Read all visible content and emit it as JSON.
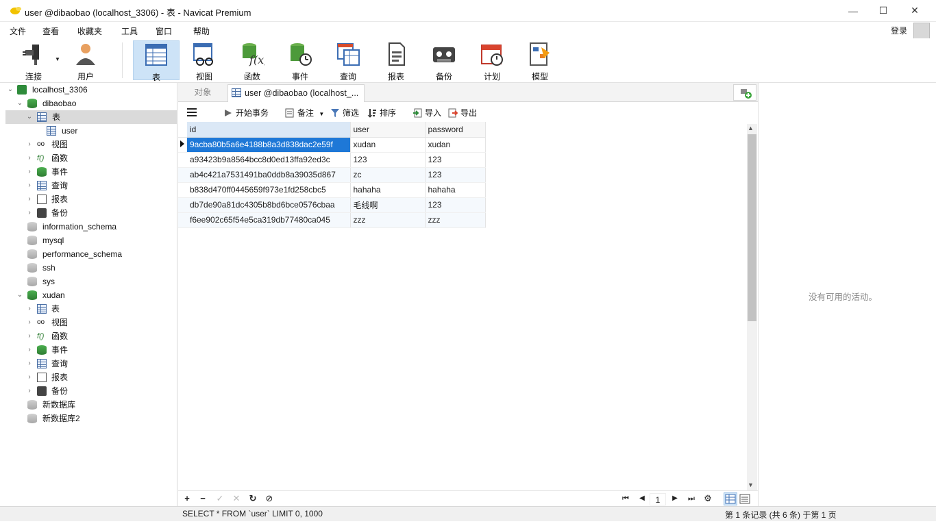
{
  "window": {
    "title": "user @dibaobao (localhost_3306) - 表 - Navicat Premium",
    "min": "—",
    "max": "☐",
    "close": "✕"
  },
  "menu": [
    "文件",
    "查看",
    "收藏夹",
    "工具",
    "窗口",
    "帮助"
  ],
  "login": "登录",
  "toolbar": [
    {
      "label": "连接",
      "icon": "plug-icon"
    },
    {
      "label": "用户",
      "icon": "user-icon"
    },
    {
      "label": "表",
      "icon": "table-icon",
      "active": true
    },
    {
      "label": "视图",
      "icon": "view-icon"
    },
    {
      "label": "函数",
      "icon": "function-icon"
    },
    {
      "label": "事件",
      "icon": "event-icon"
    },
    {
      "label": "查询",
      "icon": "query-icon"
    },
    {
      "label": "报表",
      "icon": "report-icon"
    },
    {
      "label": "备份",
      "icon": "backup-icon"
    },
    {
      "label": "计划",
      "icon": "schedule-icon"
    },
    {
      "label": "模型",
      "icon": "model-icon"
    }
  ],
  "nav": {
    "connection": "localhost_3306",
    "db1": "dibaobao",
    "db1_tables": "表",
    "db1_table_user": "user",
    "db1_items": [
      "视图",
      "函数",
      "事件",
      "查询",
      "报表",
      "备份"
    ],
    "other_dbs": [
      "information_schema",
      "mysql",
      "performance_schema",
      "ssh",
      "sys"
    ],
    "db2": "xudan",
    "db2_items": [
      "表",
      "视图",
      "函数",
      "事件",
      "查询",
      "报表",
      "备份"
    ],
    "extra_dbs": [
      "新数据库",
      "新数据库2"
    ]
  },
  "tabs": {
    "objects": "对象",
    "current": "user @dibaobao (localhost_..."
  },
  "grid_toolbar": {
    "begin_tx": "开始事务",
    "comment": "备注",
    "filter": "筛选",
    "sort": "排序",
    "import": "导入",
    "export": "导出"
  },
  "table": {
    "columns": [
      "id",
      "user",
      "password"
    ],
    "rows": [
      [
        "9acba80b5a6e4188b8a3d838dac2e59f",
        "xudan",
        "xudan"
      ],
      [
        "a93423b9a8564bcc8d0ed13ffa92ed3c",
        "123",
        "123"
      ],
      [
        "ab4c421a7531491ba0ddb8a39035d867",
        "zc",
        "123"
      ],
      [
        "b838d470ff0445659f973e1fd258cbc5",
        "hahaha",
        "hahaha"
      ],
      [
        "db7de90a81dc4305b8bd6bce0576cbaa",
        "毛线啊",
        "123"
      ],
      [
        "f6ee902c65f54e5ca319db77480ca045",
        "zzz",
        "zzz"
      ]
    ]
  },
  "bottom": {
    "add": "+",
    "remove": "−",
    "apply": "✓",
    "discard": "✕",
    "refresh": "↻",
    "stop": "⊘",
    "first": "⏮",
    "prev": "◀",
    "page": "1",
    "next": "▶",
    "last": "⏭",
    "settings": "⚙"
  },
  "status": {
    "sql": "SELECT * FROM `user` LIMIT 0, 1000",
    "records": "第 1 条记录 (共 6 条) 于第 1 页"
  },
  "right_panel": {
    "no_activity": "没有可用的活动。"
  }
}
